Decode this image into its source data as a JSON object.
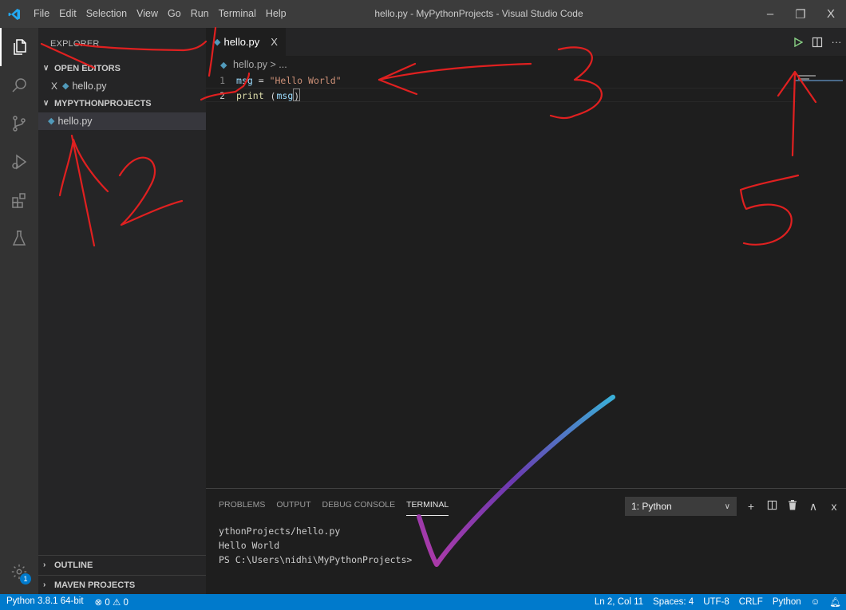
{
  "titlebar": {
    "menu": [
      "File",
      "Edit",
      "Selection",
      "View",
      "Go",
      "Run",
      "Terminal",
      "Help"
    ],
    "title": "hello.py - MyPythonProjects - Visual Studio Code",
    "minimize": "–",
    "maximize": "❐",
    "close": "X"
  },
  "sidebar": {
    "title": "EXPLORER",
    "open_editors_label": "OPEN EDITORS",
    "open_editors_file": "hello.py",
    "project_label": "MYPYTHONPROJECTS",
    "project_file": "hello.py",
    "outline_label": "OUTLINE",
    "maven_label": "MAVEN PROJECTS"
  },
  "editor": {
    "tab_label": "hello.py",
    "tab_close": "X",
    "breadcrumb_file": "hello.py",
    "breadcrumb_rest": " > ...",
    "lines": [
      {
        "num": "1",
        "tokens": [
          "msg",
          " = ",
          "\"Hello World\""
        ]
      },
      {
        "num": "2",
        "tokens": [
          "print",
          " (",
          "msg",
          ")"
        ]
      }
    ]
  },
  "panel": {
    "tabs": [
      "PROBLEMS",
      "OUTPUT",
      "DEBUG CONSOLE",
      "TERMINAL"
    ],
    "terminal_select": "1: Python",
    "output": [
      "ythonProjects/hello.py",
      "Hello World",
      "PS C:\\Users\\nidhi\\MyPythonProjects>"
    ]
  },
  "statusbar": {
    "python": "Python 3.8.1 64-bit",
    "problems": "⊗ 0 ⚠ 0",
    "position": "Ln 2, Col 11",
    "spaces": "Spaces: 4",
    "encoding": "UTF-8",
    "eol": "CRLF",
    "language": "Python"
  },
  "activity": {
    "badge_count": "1"
  },
  "annotations": {
    "labels": [
      "1",
      "2",
      "3",
      "4",
      "5"
    ],
    "color": "#e02020"
  },
  "colors": {
    "accent": "#007acc",
    "titlebar": "#3c3c3c",
    "sidebar": "#252526",
    "editor": "#1e1e1e"
  }
}
